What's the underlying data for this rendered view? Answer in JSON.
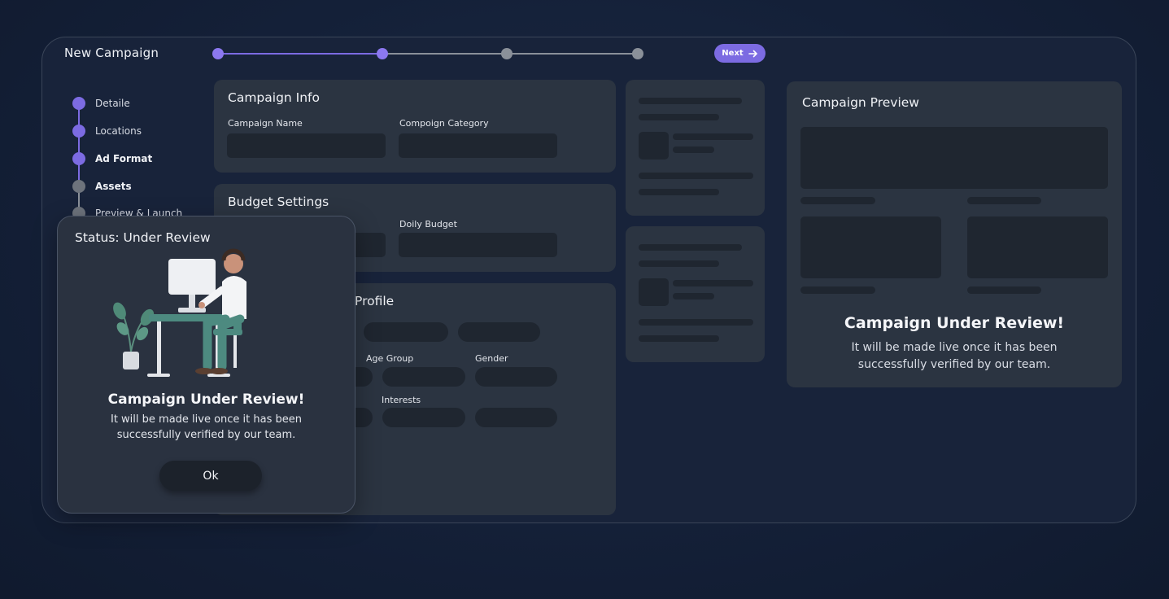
{
  "header": {
    "title": "New Campaign",
    "next_label": "Next"
  },
  "progress": {
    "current_step": 2,
    "total_steps": 4
  },
  "steps": [
    {
      "label": "Detaile",
      "state": "done"
    },
    {
      "label": "Locations",
      "state": "done"
    },
    {
      "label": "Ad Format",
      "state": "current"
    },
    {
      "label": "Assets",
      "state": "pending"
    },
    {
      "label": "Preview & Launch",
      "state": "pending"
    }
  ],
  "campaign_info": {
    "title": "Campaign Info",
    "name_label": "Campaign Name",
    "category_label": "Compoign Category"
  },
  "budget": {
    "title": "Budget Settings",
    "daily_label": "Doily Budget"
  },
  "audience": {
    "title_fragment": "Profile",
    "age_label": "Age Group",
    "gender_label": "Gender",
    "interests_label": "Interests"
  },
  "preview": {
    "title": "Campaign Preview",
    "heading": "Campaign Under Review!",
    "body_line1": "It will be made live once it has been",
    "body_line2": "successfully verified by our team."
  },
  "modal": {
    "title": "Status: Under Review",
    "heading": "Campaign Under Review!",
    "body_line1": "It will be made live once it has been",
    "body_line2": "successfully verified by our team.",
    "ok_label": "Ok"
  },
  "colors": {
    "accent": "#7c6be2",
    "pending": "#8a9099",
    "card": "#2b3441",
    "bg": "#142038"
  }
}
